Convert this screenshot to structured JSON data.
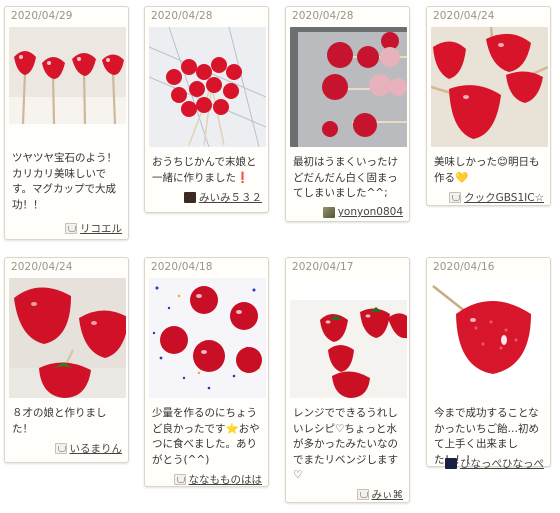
{
  "cards": [
    {
      "date": "2020/04/29",
      "text": "ツヤツヤ宝石のよう！カリカリ美味しいです。マグカップで大成功！！",
      "user": "リコエル",
      "user_icon": "default-user-icon"
    },
    {
      "date": "2020/04/28",
      "text": "おうちじかんで末娘と一緒に作りました❗️",
      "user": "みいみ５３２",
      "user_icon": "user-avatar-icon"
    },
    {
      "date": "2020/04/28",
      "text": "最初はうまくいったけどだんだん白く固まってしまいました^^;",
      "user": "yonyon0804",
      "user_icon": "user-avatar-icon"
    },
    {
      "date": "2020/04/24",
      "text": "美味しかった😊明日も作る💛",
      "user": "クックGBS1IC☆",
      "user_icon": "default-user-icon"
    },
    {
      "date": "2020/04/24",
      "text": "８才の娘と作りました！",
      "user": "いるまりん",
      "user_icon": "default-user-icon"
    },
    {
      "date": "2020/04/18",
      "text": "少量を作るのにちょうど良かったです⭐️おやつに食べました。ありがとう(^^)",
      "user": "ななもものはは",
      "user_icon": "default-user-icon"
    },
    {
      "date": "2020/04/17",
      "text": "レンジでできるうれしいレシピ♡ちょっと水が多かったみたいなのでまたリベンジします♡",
      "user": "みぃ⌘",
      "user_icon": "default-user-icon"
    },
    {
      "date": "2020/04/16",
      "text": "今まで成功することなかったいちご飴…初めて上手く出来ました！！！",
      "user": "ひなっぺひなっぺ",
      "user_icon": "user-avatar-icon"
    }
  ],
  "colors": {
    "strawberry": "#d8142a",
    "background": "#ffffff",
    "card": "#fffefa"
  }
}
